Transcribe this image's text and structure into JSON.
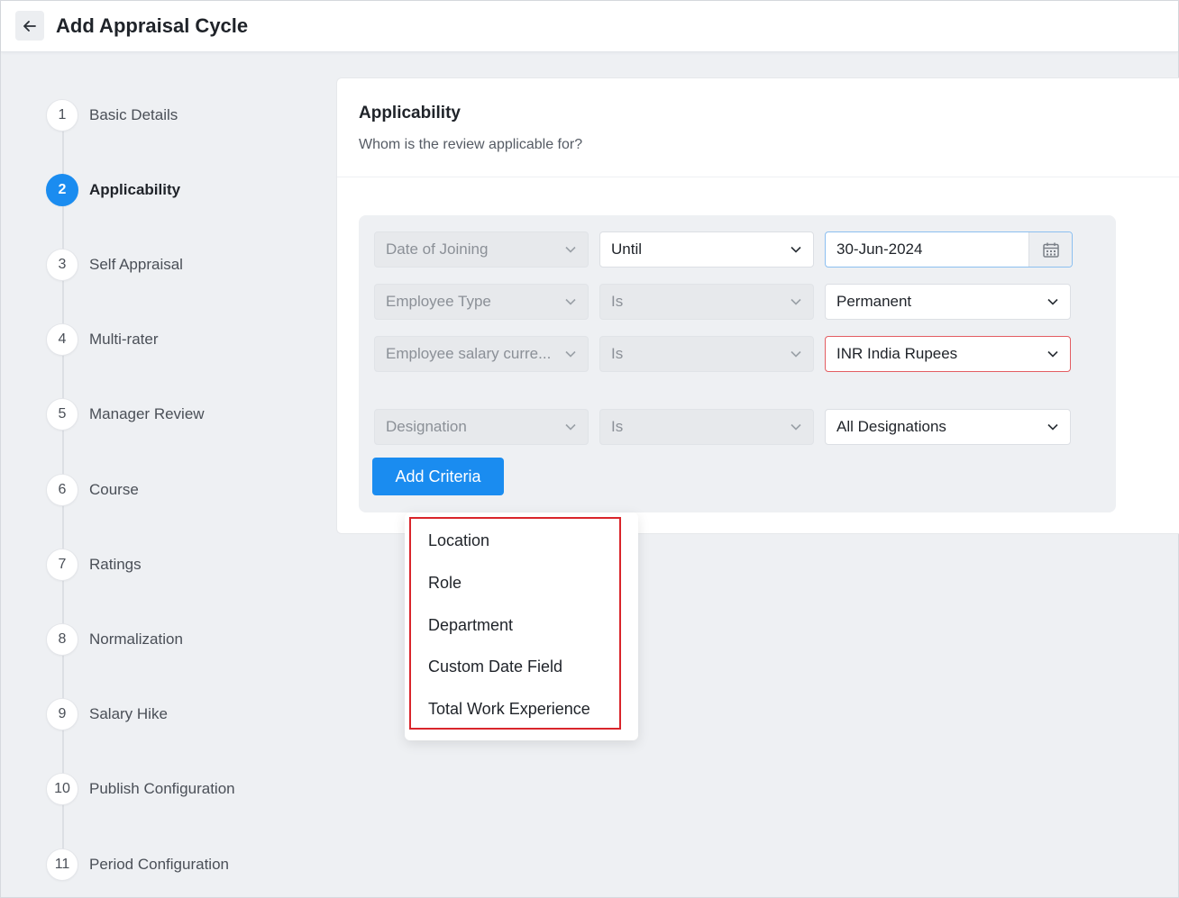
{
  "header": {
    "title": "Add Appraisal Cycle"
  },
  "steps": [
    {
      "num": "1",
      "label": "Basic Details"
    },
    {
      "num": "2",
      "label": "Applicability"
    },
    {
      "num": "3",
      "label": "Self Appraisal"
    },
    {
      "num": "4",
      "label": "Multi-rater"
    },
    {
      "num": "5",
      "label": "Manager Review"
    },
    {
      "num": "6",
      "label": "Course"
    },
    {
      "num": "7",
      "label": "Ratings"
    },
    {
      "num": "8",
      "label": "Normalization"
    },
    {
      "num": "9",
      "label": "Salary Hike"
    },
    {
      "num": "10",
      "label": "Publish Configuration"
    },
    {
      "num": "11",
      "label": "Period Configuration"
    }
  ],
  "active_step": "2",
  "card": {
    "title": "Applicability",
    "subtitle": "Whom is the review applicable for?"
  },
  "criteria": [
    {
      "field": "Date of Joining",
      "operator": "Until",
      "value": "30-Jun-2024"
    },
    {
      "field": "Employee Type",
      "operator": "Is",
      "value": "Permanent"
    },
    {
      "field": "Employee salary curre...",
      "operator": "Is",
      "value": "INR India Rupees"
    },
    {
      "field": "Designation",
      "operator": "Is",
      "value": "All Designations"
    }
  ],
  "add_criteria_label": "Add Criteria",
  "dropdown_options": [
    "Location",
    "Role",
    "Department",
    "Custom Date Field",
    "Total Work Experience"
  ],
  "colors": {
    "accent": "#1a8cf0",
    "error_border": "#e35d62",
    "highlight": "#d9252b"
  }
}
